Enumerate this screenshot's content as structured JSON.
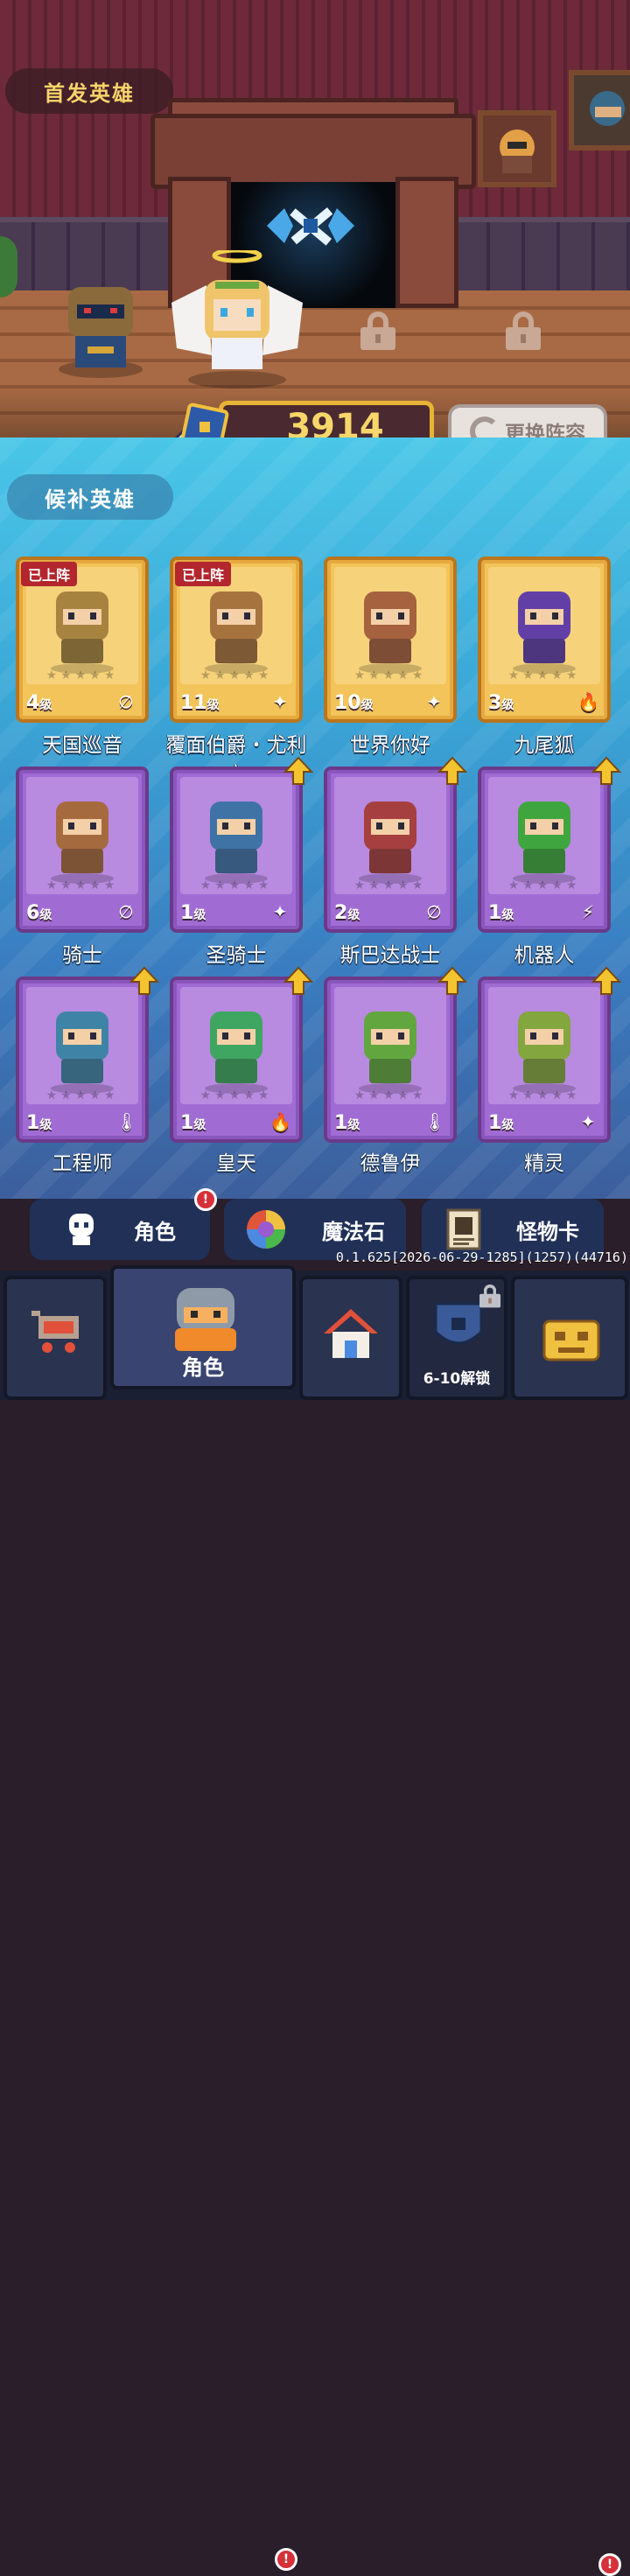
{
  "lineup": {
    "title": "首发英雄",
    "power": "3914",
    "swap_label": "更换阵容"
  },
  "reserve": {
    "title": "候补英雄",
    "heroes": [
      {
        "name": "天国巡音",
        "level": "4",
        "level_unit": "级",
        "element": "∅",
        "element_icon": "void-element-icon",
        "deployed": "已上阵",
        "frame": "gold"
      },
      {
        "name": "覆面伯爵・尤利安",
        "level": "11",
        "level_unit": "级",
        "element": "✦",
        "element_icon": "sparkle-element-icon",
        "deployed": "已上阵",
        "frame": "gold"
      },
      {
        "name": "世界你好",
        "level": "10",
        "level_unit": "级",
        "element": "✦",
        "element_icon": "sparkle-element-icon",
        "frame": "gold"
      },
      {
        "name": "九尾狐",
        "level": "3",
        "level_unit": "级",
        "element": "🔥",
        "element_icon": "fire-element-icon",
        "frame": "gold"
      },
      {
        "name": "骑士",
        "level": "6",
        "level_unit": "级",
        "element": "∅",
        "element_icon": "void-element-icon",
        "frame": "purple"
      },
      {
        "name": "圣骑士",
        "level": "1",
        "level_unit": "级",
        "element": "✦",
        "element_icon": "sparkle-element-icon",
        "frame": "purple",
        "upgrade": true
      },
      {
        "name": "斯巴达战士",
        "level": "2",
        "level_unit": "级",
        "element": "∅",
        "element_icon": "void-element-icon",
        "frame": "purple",
        "upgrade": true
      },
      {
        "name": "机器人",
        "level": "1",
        "level_unit": "级",
        "element": "⚡",
        "element_icon": "lightning-element-icon",
        "frame": "purple",
        "upgrade": true
      },
      {
        "name": "工程师",
        "level": "1",
        "level_unit": "级",
        "element": "🌡",
        "element_icon": "thermometer-element-icon",
        "frame": "purple",
        "upgrade": true
      },
      {
        "name": "皇天",
        "level": "1",
        "level_unit": "级",
        "element": "🔥",
        "element_icon": "fire-element-icon",
        "frame": "purple",
        "upgrade": true
      },
      {
        "name": "德鲁伊",
        "level": "1",
        "level_unit": "级",
        "element": "🌡",
        "element_icon": "thermometer-element-icon",
        "frame": "purple",
        "upgrade": true
      },
      {
        "name": "精灵",
        "level": "1",
        "level_unit": "级",
        "element": "✦",
        "element_icon": "sparkle-element-icon",
        "frame": "purple",
        "upgrade": true
      }
    ]
  },
  "subtabs": {
    "character": "角色",
    "magic_stone": "魔法石",
    "monster_card": "怪物卡",
    "alert": "!"
  },
  "version": "0.1.625[2026-06-29-1285](1257)(44716)",
  "nav": {
    "shop_icon": "cart-icon",
    "character": "角色",
    "home_icon": "house-icon",
    "guild_unlock": "6-10解锁",
    "treasure_icon": "treasure-icon"
  },
  "colors": {
    "power_border": "#e8b436",
    "gold_card": "#f2c45a",
    "purple_card": "#a06cd4",
    "deployed_tag": "#b3262e",
    "alert_badge": "#d6303a"
  }
}
